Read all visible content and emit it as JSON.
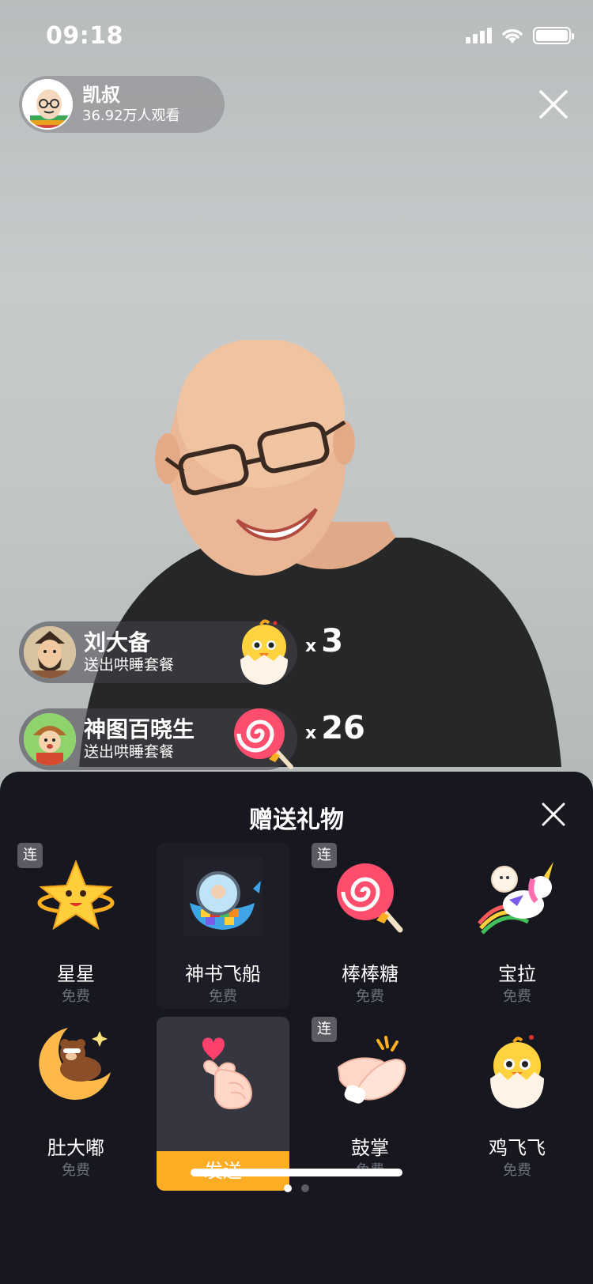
{
  "status_bar": {
    "time": "09:18"
  },
  "host": {
    "name": "凯叔",
    "viewers": "36.92万人观看"
  },
  "notifications": [
    {
      "name": "刘大备",
      "message": "送出哄睡套餐",
      "gift_icon": "chick-in-egg-icon",
      "count": "3",
      "multiplier": "x"
    },
    {
      "name": "神图百晓生",
      "message": "送出哄睡套餐",
      "gift_icon": "lollipop-icon",
      "count": "26",
      "multiplier": "x"
    }
  ],
  "gift_panel": {
    "title": "赠送礼物",
    "combo_label": "连",
    "send_label": "发送",
    "gifts": [
      {
        "name": "星星",
        "price": "免费",
        "icon": "star-icon",
        "combo": true
      },
      {
        "name": "神书飞船",
        "price": "免费",
        "icon": "whale-spaceship-icon",
        "combo": false
      },
      {
        "name": "棒棒糖",
        "price": "免费",
        "icon": "lollipop-icon",
        "combo": true
      },
      {
        "name": "宝拉",
        "price": "免费",
        "icon": "unicorn-icon",
        "combo": false
      },
      {
        "name": "肚大嘟",
        "price": "免费",
        "icon": "bear-on-moon-icon",
        "combo": false
      },
      {
        "name": "",
        "price": "",
        "icon": "finger-heart-icon",
        "combo": false,
        "selected": true
      },
      {
        "name": "鼓掌",
        "price": "免费",
        "icon": "clapping-hands-icon",
        "combo": true
      },
      {
        "name": "鸡飞飞",
        "price": "免费",
        "icon": "chick-in-egg-icon",
        "combo": false
      }
    ],
    "page_count": 2,
    "current_page": 1
  },
  "colors": {
    "panel_bg": "#16171f",
    "send_button": "#fcad24",
    "selected_cell": "#35363f"
  }
}
